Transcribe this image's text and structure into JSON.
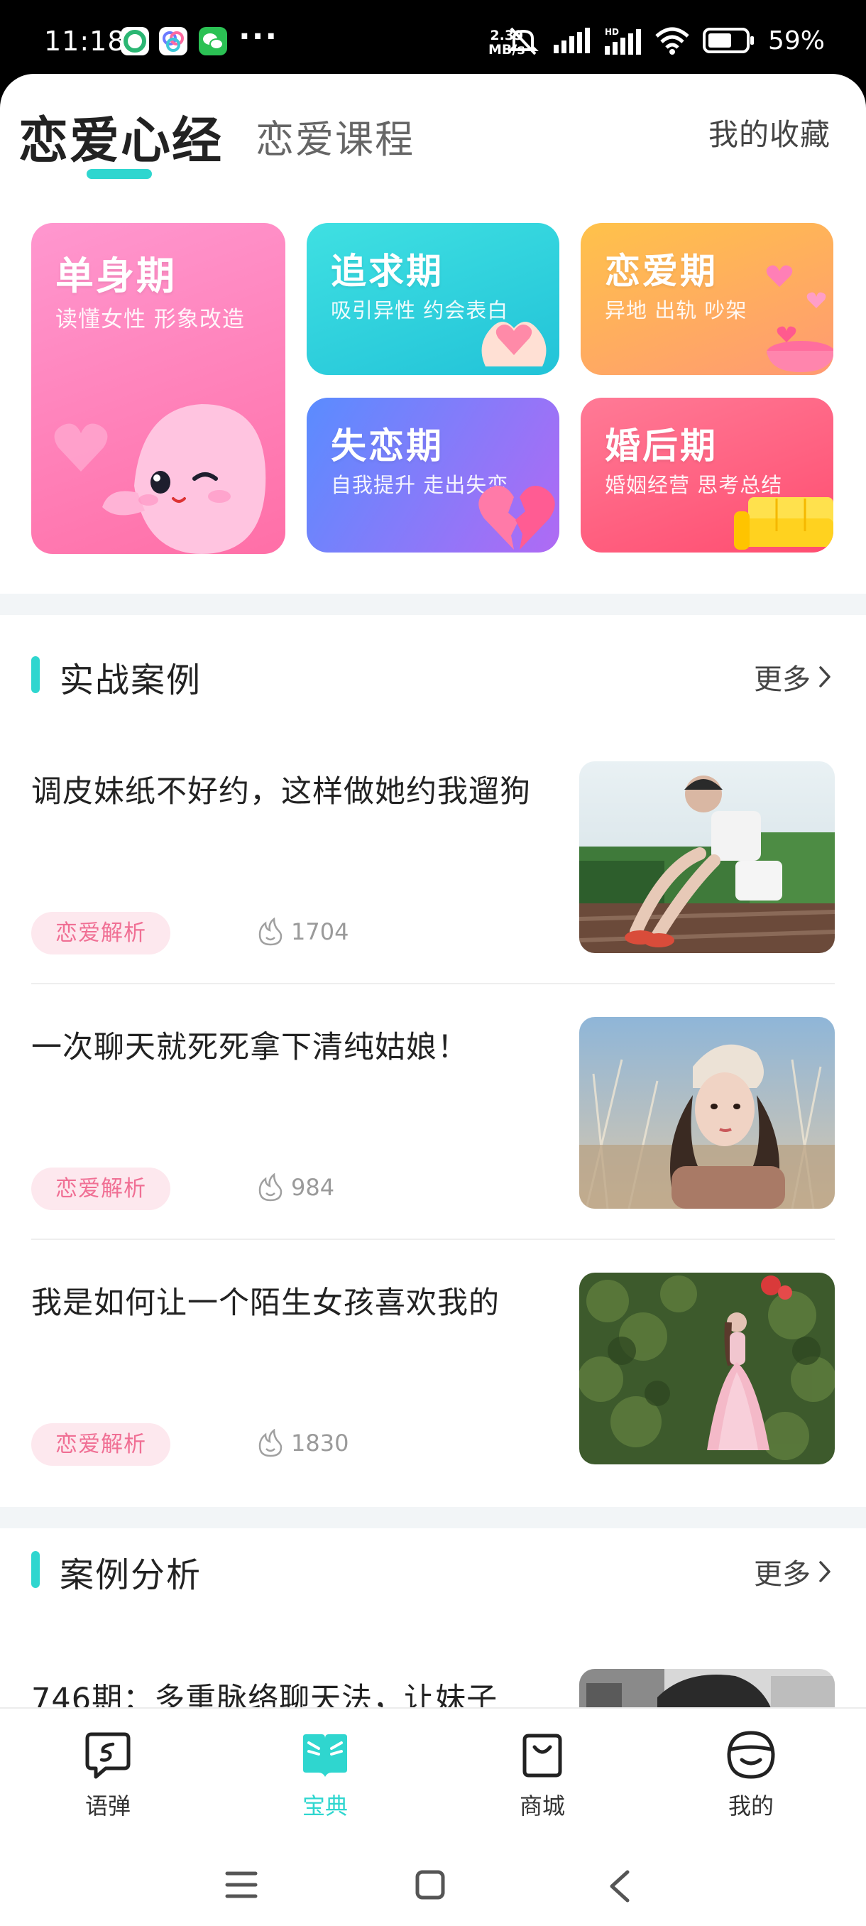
{
  "status_bar": {
    "time": "11:18",
    "speed_value": "2.39",
    "speed_unit": "MB/s",
    "battery": "59%",
    "dots": "···"
  },
  "top_tabs": {
    "active": "恋爱心经",
    "inactive": "恋爱课程",
    "favorites": "我的收藏"
  },
  "stage_cards": [
    {
      "title": "单身期",
      "subtitle": "读懂女性 形象改造",
      "colors": [
        "#ff8ec8",
        "#ff6fa8"
      ]
    },
    {
      "title": "追求期",
      "subtitle": "吸引异性 约会表白",
      "colors": [
        "#35dbe0",
        "#27c6d8"
      ]
    },
    {
      "title": "恋爱期",
      "subtitle": "异地 出轨 吵架",
      "colors": [
        "#ffc04a",
        "#ff9a6a"
      ]
    },
    {
      "title": "失恋期",
      "subtitle": "自我提升 走出失恋",
      "colors": [
        "#5e8cff",
        "#b068f4"
      ]
    },
    {
      "title": "婚后期",
      "subtitle": "婚姻经营 思考总结",
      "colors": [
        "#ff7592",
        "#ff4f72"
      ]
    }
  ],
  "section_cases": {
    "title": "实战案例",
    "more": "更多",
    "articles": [
      {
        "title": "调皮妹纸不好约，这样做她约我遛狗",
        "tag": "恋爱解析",
        "views": "1704"
      },
      {
        "title": "一次聊天就死死拿下清纯姑娘！",
        "tag": "恋爱解析",
        "views": "984"
      },
      {
        "title": "我是如何让一个陌生女孩喜欢我的",
        "tag": "恋爱解析",
        "views": "1830"
      }
    ]
  },
  "section_analysis": {
    "title": "案例分析",
    "more": "更多",
    "articles": [
      {
        "title": "746期：多重脉络聊天法，让妹子"
      }
    ]
  },
  "bottom_nav": {
    "items": [
      {
        "label": "语弹",
        "icon": "chat-bubble-icon",
        "active": false
      },
      {
        "label": "宝典",
        "icon": "book-icon",
        "active": true
      },
      {
        "label": "商城",
        "icon": "shopping-bag-icon",
        "active": false
      },
      {
        "label": "我的",
        "icon": "smiley-face-icon",
        "active": false
      }
    ]
  },
  "theme": {
    "accent": "#2fd6cf",
    "tag_bg": "#fde8ee",
    "tag_text": "#f06f94"
  }
}
